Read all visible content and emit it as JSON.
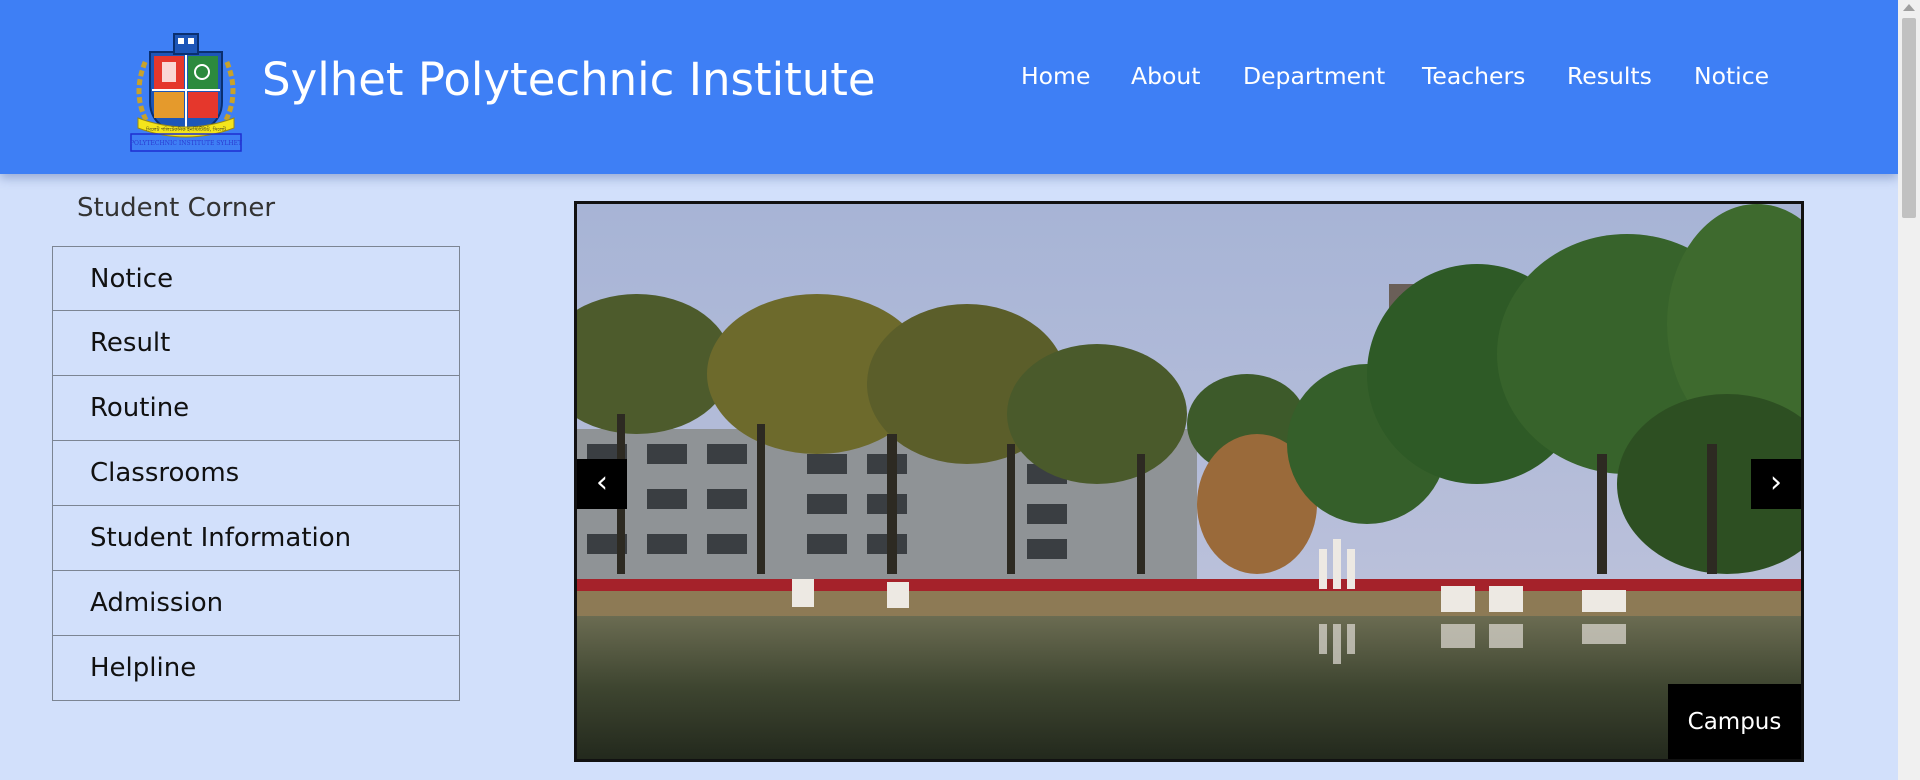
{
  "header": {
    "title": "Sylhet Polytechnic Institute",
    "logo_icon": "institute-emblem-icon",
    "logo_ribbon_text": "সিলেট পলিটেকনিক ইনস্টিটিউট, সিলেট",
    "logo_caption": "POLYTECHNIC INSTITUTE SYLHET",
    "background_color": "#3e7ff5"
  },
  "nav": {
    "items": [
      "Home",
      "About",
      "Department",
      "Teachers",
      "Results",
      "Notice"
    ]
  },
  "sidebar": {
    "heading": "Student Corner",
    "items": [
      "Notice",
      "Result",
      "Routine",
      "Classrooms",
      "Student Information",
      "Admission",
      "Helpline"
    ]
  },
  "carousel": {
    "prev_icon": "chevron-left-icon",
    "next_icon": "chevron-right-icon",
    "prev_glyph": "‹",
    "next_glyph": "›",
    "caption": "Campus"
  },
  "colors": {
    "page_background": "#d2e0fb",
    "header": "#3e7ff5",
    "carousel_controls": "#000000"
  }
}
